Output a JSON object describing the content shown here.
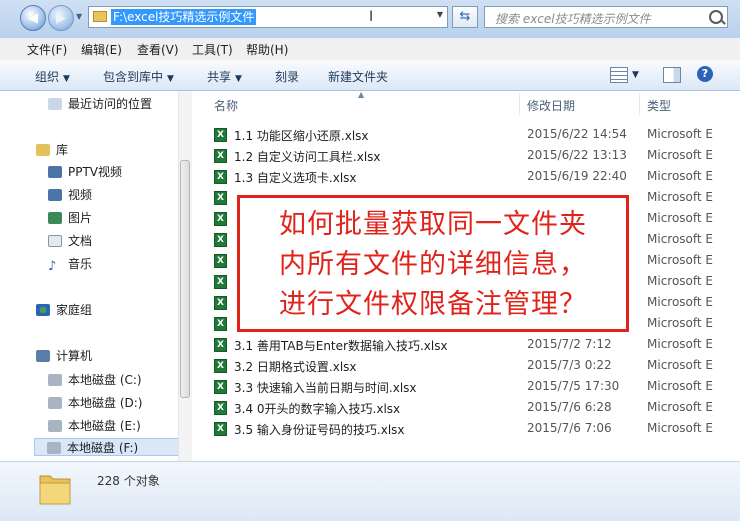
{
  "address": {
    "path": "F:\\excel技巧精选示例文件"
  },
  "search": {
    "placeholder": "搜索 excel技巧精选示例文件"
  },
  "menu": [
    "文件(F)",
    "编辑(E)",
    "查看(V)",
    "工具(T)",
    "帮助(H)"
  ],
  "toolbar": {
    "organize": "组织",
    "include": "包含到库中",
    "share": "共享",
    "burn": "刻录",
    "new_folder": "新建文件夹"
  },
  "nav": {
    "recent": "最近访问的位置",
    "library": "库",
    "pptv": "PPTV视频",
    "video": "视频",
    "pictures": "图片",
    "docs": "文档",
    "music": "音乐",
    "homegroup": "家庭组",
    "computer": "计算机",
    "drives": [
      "本地磁盘 (C:)",
      "本地磁盘 (D:)",
      "本地磁盘 (E:)",
      "本地磁盘 (F:)"
    ]
  },
  "columns": {
    "name": "名称",
    "date": "修改日期",
    "type": "类型"
  },
  "files": [
    {
      "name": "1.1 功能区缩小还原.xlsx",
      "date": "2015/6/22 14:54",
      "type": "Microsoft E"
    },
    {
      "name": "1.2 自定义访问工具栏.xlsx",
      "date": "2015/6/22 13:13",
      "type": "Microsoft E"
    },
    {
      "name": "1.3 自定义选项卡.xlsx",
      "date": "2015/6/19 22:40",
      "type": "Microsoft E"
    },
    {
      "name": "",
      "date": "",
      "type": "Microsoft E"
    },
    {
      "name": "",
      "date": "",
      "type": "Microsoft E"
    },
    {
      "name": "",
      "date": "",
      "type": "Microsoft E"
    },
    {
      "name": "",
      "date": "",
      "type": "Microsoft E"
    },
    {
      "name": "",
      "date": "",
      "type": "Microsoft E"
    },
    {
      "name": "",
      "date": "",
      "type": "Microsoft E"
    },
    {
      "name": "",
      "date": "",
      "type": "Microsoft E"
    },
    {
      "name": "3.1 善用TAB与Enter数据输入技巧.xlsx",
      "date": "2015/7/2 7:12",
      "type": "Microsoft E"
    },
    {
      "name": "3.2 日期格式设置.xlsx",
      "date": "2015/7/3 0:22",
      "type": "Microsoft E"
    },
    {
      "name": "3.3 快速输入当前日期与时间.xlsx",
      "date": "2015/7/5 17:30",
      "type": "Microsoft E"
    },
    {
      "name": "3.4 0开头的数字输入技巧.xlsx",
      "date": "2015/7/6 6:28",
      "type": "Microsoft E"
    },
    {
      "name": "3.5 输入身份证号码的技巧.xlsx",
      "date": "2015/7/6 7:06",
      "type": "Microsoft E"
    }
  ],
  "status": {
    "count": "228 个对象"
  },
  "overlay": {
    "lines": [
      "如何批量获取同一文件夹",
      "内所有文件的详细信息，",
      "进行文件权限备注管理？"
    ]
  },
  "colors": {
    "accent": "#3399ff",
    "overlay_red": "#e0241b",
    "excel_green": "#1f7a37"
  }
}
